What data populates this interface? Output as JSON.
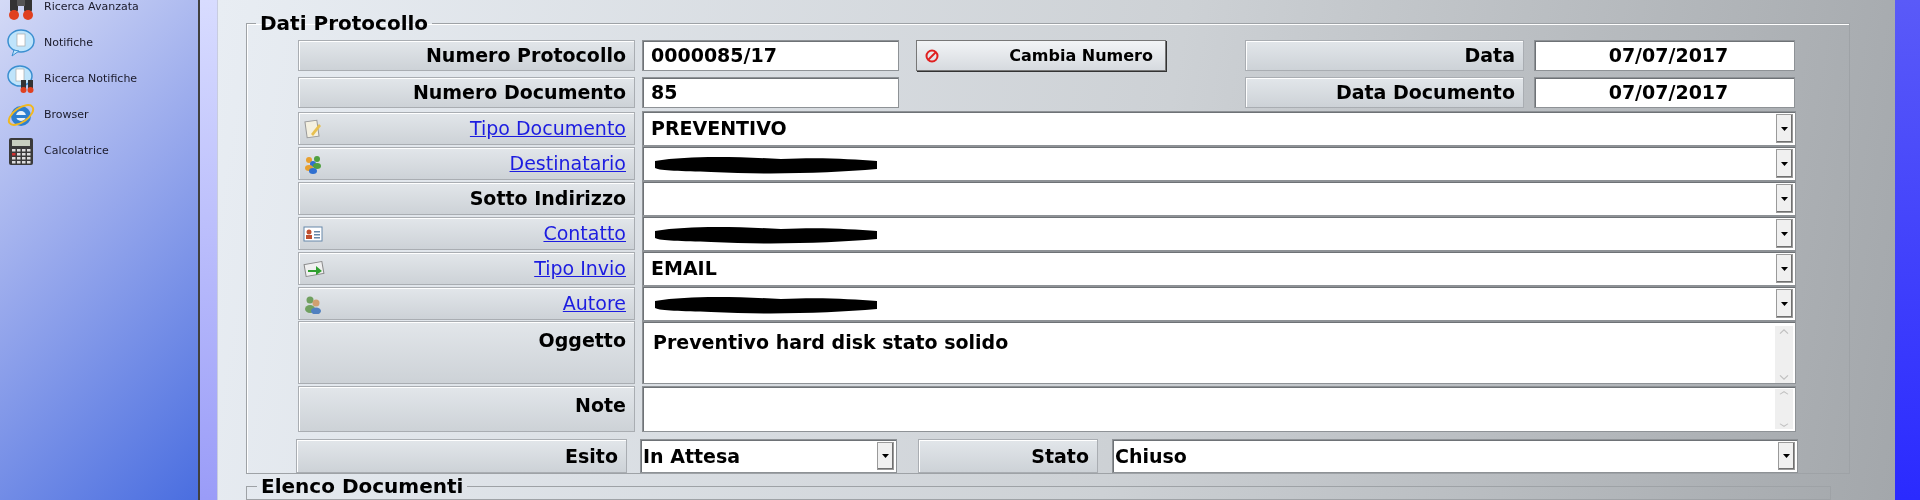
{
  "sidebar": {
    "items": [
      {
        "label": "Ricerca Avanzata",
        "kind": "search"
      },
      {
        "label": "Notifiche",
        "kind": "notification"
      },
      {
        "label": "Ricerca Notifiche",
        "kind": "notification-search"
      },
      {
        "label": "Browser",
        "kind": "browser"
      },
      {
        "label": "Calcolatrice",
        "kind": "calculator"
      }
    ]
  },
  "dati_protocollo": {
    "legend": "Dati Protocollo",
    "numero_protocollo": {
      "label": "Numero Protocollo",
      "value": "0000085/17"
    },
    "cambia_numero_button": "Cambia Numero",
    "data": {
      "label": "Data",
      "value": "07/07/2017"
    },
    "numero_documento": {
      "label": "Numero Documento",
      "value": "85"
    },
    "data_documento": {
      "label": "Data Documento",
      "value": "07/07/2017"
    },
    "rows": [
      {
        "label": "Tipo Documento",
        "linked": true,
        "value": "PREVENTIVO",
        "redacted": false
      },
      {
        "label": "Destinatario",
        "linked": true,
        "redacted": true
      },
      {
        "label": "Sotto Indirizzo",
        "linked": false,
        "redacted": false
      },
      {
        "label": "Contatto",
        "linked": true,
        "redacted": true
      },
      {
        "label": "Tipo Invio",
        "linked": true,
        "value": "EMAIL",
        "redacted": false
      },
      {
        "label": "Autore",
        "linked": true,
        "redacted": true
      }
    ],
    "oggetto": {
      "label": "Oggetto",
      "value": "Preventivo hard disk stato solido"
    },
    "note": {
      "label": "Note"
    },
    "esito": {
      "label": "Esito",
      "value": "In Attesa"
    },
    "stato": {
      "label": "Stato",
      "value": "Chiuso"
    }
  },
  "elenco_documenti": {
    "legend": "Elenco Documenti"
  }
}
